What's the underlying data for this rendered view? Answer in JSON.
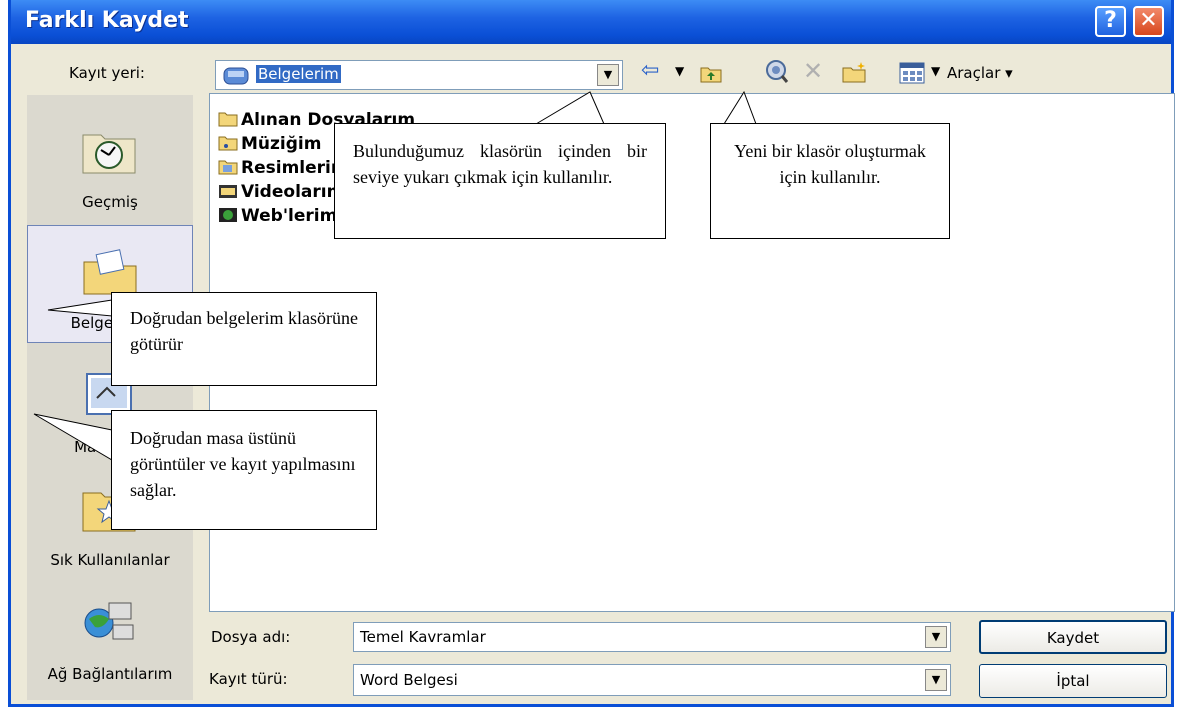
{
  "window": {
    "title": "Farklı Kaydet",
    "help_label": "?",
    "close_label": "✕"
  },
  "location": {
    "label": "Kayıt yeri:",
    "value": "Belgelerim"
  },
  "toolbar": {
    "tools_label": "Araçlar"
  },
  "sidebar": {
    "items": [
      {
        "label": "Geçmiş",
        "icon": "history-icon"
      },
      {
        "label": "Belgelerim",
        "icon": "my-documents-icon"
      },
      {
        "label": "Masaüstü",
        "icon": "desktop-icon"
      },
      {
        "label": "Sık Kullanılanlar",
        "icon": "favorites-icon"
      },
      {
        "label": "Ağ Bağlantılarım",
        "icon": "network-icon"
      }
    ]
  },
  "files": [
    {
      "name": "Alınan Dosyalarım",
      "icon": "folder-icon"
    },
    {
      "name": "Müziğim",
      "icon": "music-folder-icon"
    },
    {
      "name": "Resimlerim",
      "icon": "pictures-folder-icon"
    },
    {
      "name": "Videolarım",
      "icon": "video-folder-icon"
    },
    {
      "name": "Web'lerim",
      "icon": "web-folder-icon"
    }
  ],
  "form": {
    "filename_label": "Dosya adı:",
    "filename_value": "Temel Kavramlar",
    "filetype_label": "Kayıt türü:",
    "filetype_value": "Word Belgesi"
  },
  "buttons": {
    "save": "Kaydet",
    "cancel": "İptal"
  },
  "callouts": {
    "up_folder": "Bulunduğumuz klasörün içinden bir seviye yukarı çıkmak için kullanılır.",
    "new_folder": "Yeni bir klasör oluşturmak için kullanılır.",
    "my_documents": "Doğrudan belgelerim klasörüne götürür",
    "desktop": "Doğrudan masa üstünü görüntüler ve kayıt yapılmasını sağlar."
  }
}
